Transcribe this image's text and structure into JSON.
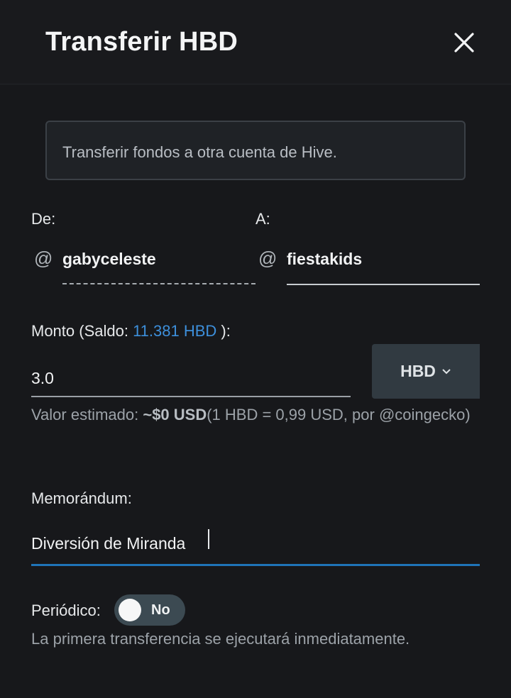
{
  "dialog": {
    "title": "Transferir HBD",
    "close_icon": "close-icon",
    "info": "Transferir fondos a otra cuenta de Hive."
  },
  "from": {
    "label": "De:",
    "prefix": "@",
    "account": "gabyceleste"
  },
  "to": {
    "label": "A:",
    "prefix": "@",
    "account": "fiestakids"
  },
  "amount": {
    "label_prefix": "Monto (Saldo: ",
    "balance": "11.381 HBD",
    "label_suffix": " ):",
    "value": "3.0",
    "currency": "HBD",
    "currency_icon": "chevron-down-icon"
  },
  "estimate": {
    "prefix": "Valor estimado: ",
    "value": "~$0 USD",
    "suffix": "(1 HBD = 0,99 USD, por @coingecko)"
  },
  "memo": {
    "label": "Memorándum:",
    "value": "Diversión de Miranda"
  },
  "recurrent": {
    "label": "Periódico:",
    "toggle_label": "No",
    "enabled": false,
    "note": "La primera transferencia se ejecutará inmediatamente."
  },
  "colors": {
    "accent": "#1f74b8",
    "link": "#3d8fdb",
    "background": "#17181b"
  }
}
